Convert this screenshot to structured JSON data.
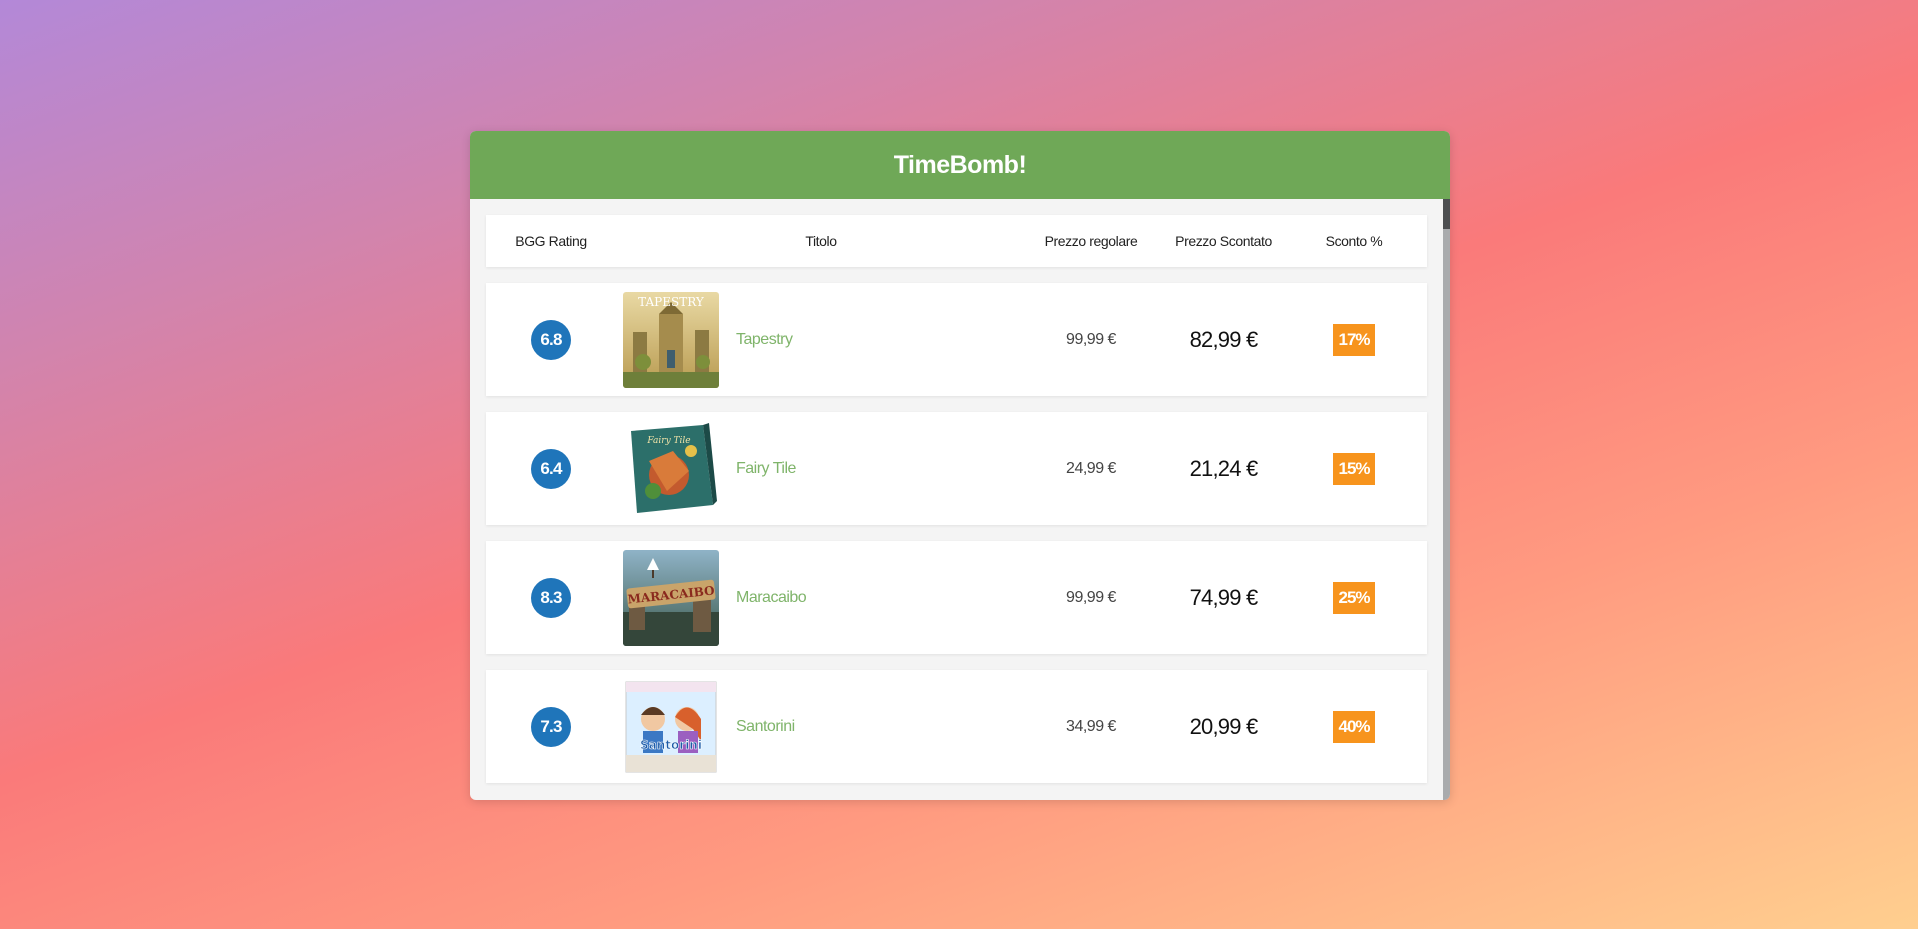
{
  "panel": {
    "title": "TimeBomb!"
  },
  "columns": {
    "rating": "BGG Rating",
    "title": "Titolo",
    "regular_price": "Prezzo regolare",
    "discounted_price": "Prezzo Scontato",
    "discount_percent": "Sconto %"
  },
  "colors": {
    "header_bg": "#6fa857",
    "rating_badge": "#1f75ba",
    "discount_badge": "#f7941d",
    "title_link": "#7fb46a"
  },
  "games": [
    {
      "rating": "6.8",
      "title": "Tapestry",
      "regular_price": "99,99 €",
      "discounted_price": "82,99 €",
      "discount": "17%",
      "cover_text": "TAPESTRY"
    },
    {
      "rating": "6.4",
      "title": "Fairy Tile",
      "regular_price": "24,99 €",
      "discounted_price": "21,24 €",
      "discount": "15%",
      "cover_text": "Fairy Tile"
    },
    {
      "rating": "8.3",
      "title": "Maracaibo",
      "regular_price": "99,99 €",
      "discounted_price": "74,99 €",
      "discount": "25%",
      "cover_text": "MARACAIBO"
    },
    {
      "rating": "7.3",
      "title": "Santorini",
      "regular_price": "34,99 €",
      "discounted_price": "20,99 €",
      "discount": "40%",
      "cover_text": "Santorini"
    }
  ]
}
